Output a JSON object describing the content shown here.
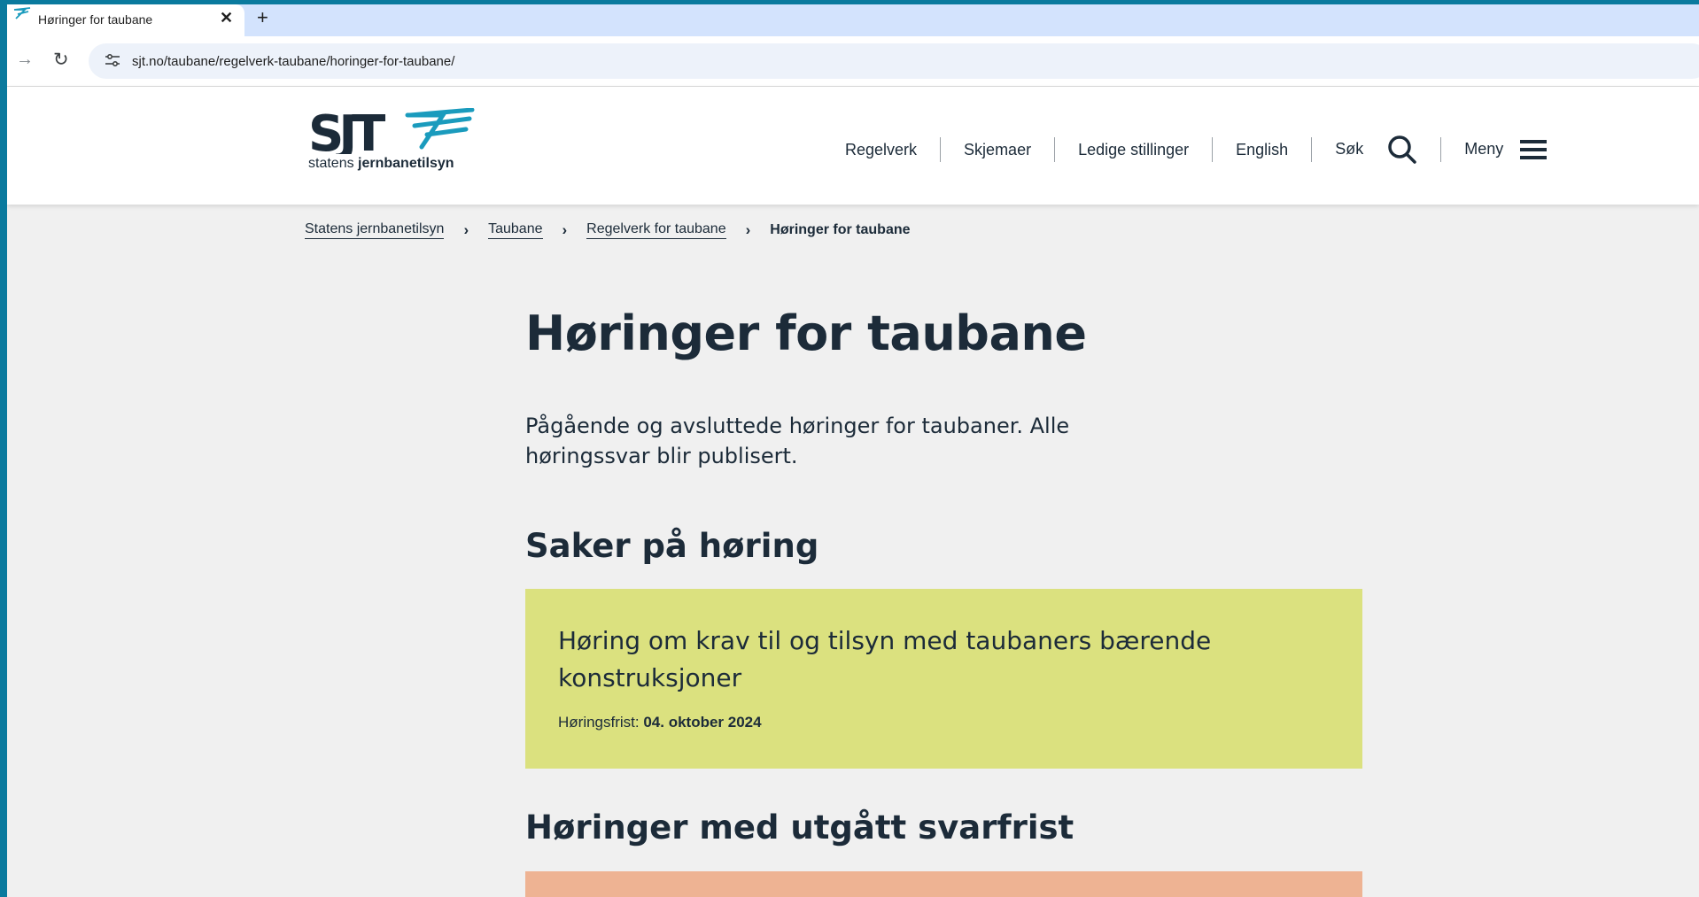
{
  "browser": {
    "tab_title": "Høringer for taubane",
    "tab_close": "✕",
    "new_tab": "+",
    "url": "sjt.no/taubane/regelverk-taubane/horinger-for-taubane/"
  },
  "header": {
    "logo_text_light": "statens ",
    "logo_text_bold": "jernbanetilsyn",
    "nav": {
      "regelverk": "Regelverk",
      "skjemaer": "Skjemaer",
      "ledige": "Ledige stillinger",
      "english": "English",
      "sok": "Søk",
      "meny": "Meny"
    }
  },
  "breadcrumb": {
    "items": [
      "Statens jernbanetilsyn",
      "Taubane",
      "Regelverk for taubane"
    ],
    "current": "Høringer for taubane",
    "separator": "›"
  },
  "main": {
    "title": "Høringer for taubane",
    "lead": "Pågående og avsluttede høringer for taubaner. Alle høringssvar blir publisert.",
    "section_open": "Saker på høring",
    "open_card": {
      "title": "Høring om krav til og tilsyn med taubaners bærende konstruksjoner",
      "deadline_label": "Høringsfrist: ",
      "deadline_value": "04. oktober 2024"
    },
    "section_closed": "Høringer med utgått svarfrist"
  },
  "colors": {
    "brand_dark": "#1c2b39",
    "brand_accent": "#1a9bbd",
    "card_open": "#dbe17f",
    "card_closed": "#eeb393",
    "page_bg": "#f0f0f0"
  }
}
